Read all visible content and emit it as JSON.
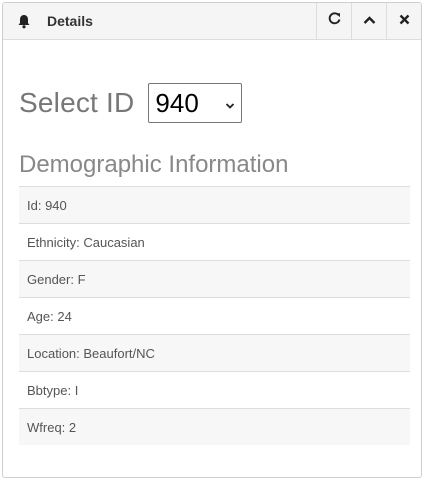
{
  "header": {
    "title": "Details",
    "icon": "bell-icon",
    "actions": [
      "refresh-icon",
      "chevron-up-icon",
      "close-icon"
    ]
  },
  "selector": {
    "label": "Select ID",
    "value": "940"
  },
  "demographics": {
    "heading": "Demographic Information",
    "rows": [
      "Id: 940",
      "Ethnicity: Caucasian",
      "Gender: F",
      "Age: 24",
      "Location: Beaufort/NC",
      "Bbtype: I",
      "Wfreq: 2"
    ]
  }
}
